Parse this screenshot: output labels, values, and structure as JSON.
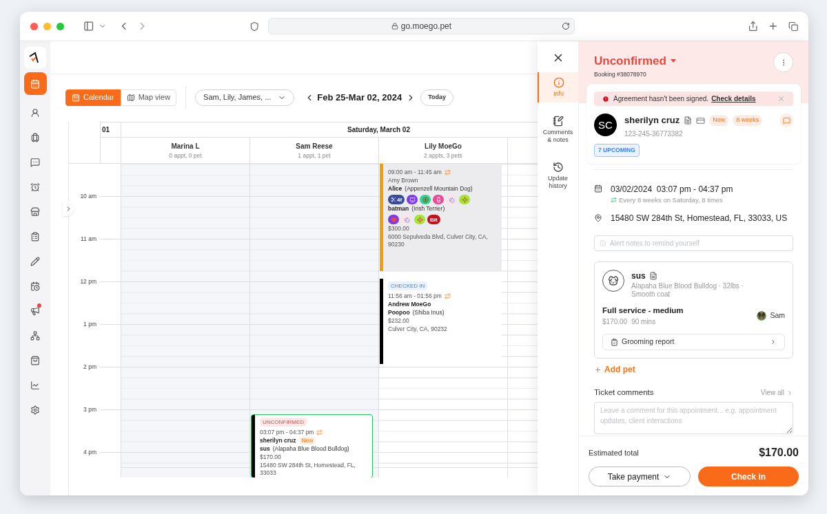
{
  "browser": {
    "url": "go.moego.pet"
  },
  "sidebar": {
    "items": [
      {
        "selected": true,
        "badge": false
      },
      {
        "selected": false,
        "badge": false
      },
      {
        "selected": false,
        "badge": false
      },
      {
        "selected": false,
        "badge": false
      },
      {
        "selected": false,
        "badge": false
      },
      {
        "selected": false,
        "badge": false
      },
      {
        "selected": false,
        "badge": false
      },
      {
        "selected": false,
        "badge": false
      },
      {
        "selected": false,
        "badge": false
      },
      {
        "selected": false,
        "badge": true
      },
      {
        "selected": false,
        "badge": false
      },
      {
        "selected": false,
        "badge": false
      },
      {
        "selected": false,
        "badge": false
      },
      {
        "selected": false,
        "badge": false
      }
    ]
  },
  "toolbar": {
    "view_tabs": [
      {
        "label": "Calendar",
        "selected": true
      },
      {
        "label": "Map view",
        "selected": false
      }
    ],
    "staff_filter": "Sam, Lily, James, ...",
    "date_range": "Feb 25-Mar 02, 2024",
    "today": "Today"
  },
  "calendar": {
    "week": "01",
    "day": "Saturday, March 02",
    "hours": [
      "10 am",
      "11 am",
      "12 pm",
      "1 pm",
      "2 pm",
      "3 pm",
      "4 pm"
    ],
    "staff": [
      {
        "name": "Marina L",
        "summary": "0 appt, 0 pet"
      },
      {
        "name": "Sam Reese",
        "summary": "1 appt, 1 pet",
        "appointments": [
          {
            "status": {
              "kind": "unconfirmed",
              "label": "UNCONFIRMED"
            },
            "time": "03:07 pm - 04:37 pm",
            "recurring": true,
            "client": "sherilyn cruz",
            "client_tag": "New",
            "color": "#000000",
            "highlighted": false,
            "selected": true,
            "pets": [
              {
                "name": "sus",
                "breed": "(Alapaha Blue Blood Bulldog)"
              }
            ],
            "price": "$170.00",
            "address": "15480 SW 284th St, Homestead, FL, 33033"
          }
        ]
      },
      {
        "name": "Lily MoeGo",
        "summary": "2 appts, 3 pets",
        "appointments": [
          {
            "time": "09:00 am - 11:45 am",
            "recurring": true,
            "client": "Amy Brown",
            "color": "#f59e0b",
            "highlighted": true,
            "selected": false,
            "pets": [
              {
                "name": "Alice",
                "breed": "(Appenzell Mountain Dog)",
                "tags": [
                  {
                    "kind": "count",
                    "label": "4f",
                    "color": "#3b4a9a"
                  },
                  {
                    "kind": "face",
                    "color": "#7c3aed"
                  },
                  {
                    "kind": "bag",
                    "color": "#34d399"
                  },
                  {
                    "kind": "bottle",
                    "color": "#ec4899"
                  },
                  {
                    "kind": "drops",
                    "color": "#fde2ea"
                  },
                  {
                    "kind": "burst",
                    "color": "#a3e635"
                  }
                ]
              },
              {
                "name": "batman",
                "breed": "(Irish Terrier)",
                "tags": [
                  {
                    "kind": "heart",
                    "color": "#7c3aed"
                  },
                  {
                    "kind": "drops",
                    "color": "#fde2ea"
                  },
                  {
                    "kind": "burst",
                    "color": "#a3e635"
                  },
                  {
                    "kind": "text",
                    "label": "Bit",
                    "color": "#c0121f"
                  }
                ]
              }
            ],
            "price": "$300.00",
            "address": "6000 Sepulveda Blvd, Culver City, CA, 90230"
          },
          {
            "status": {
              "kind": "checked_in",
              "label": "CHECKED IN"
            },
            "time": "11:56 am - 01:56 pm",
            "recurring": true,
            "client": "Andrew MoeGo",
            "color": "#000000",
            "highlighted": false,
            "selected": false,
            "pets": [
              {
                "name": "Poopoo",
                "breed": "(Shiba Inus)"
              }
            ],
            "price": "$232.00",
            "address": "Culver City, CA, 90232"
          }
        ]
      }
    ]
  },
  "drawer": {
    "tabs": [
      {
        "label": "Info",
        "selected": true
      },
      {
        "label": "Comments & notes",
        "selected": false
      },
      {
        "label": "Update history",
        "selected": false
      }
    ],
    "status": "Unconfirmed",
    "booking": "Booking #38078970",
    "alert": {
      "text": "Agreement hasn't been signed.",
      "link": "Check details"
    },
    "client": {
      "initials": "SC",
      "name": "sherilyn cruz",
      "tags": [
        "New",
        "8 weeks"
      ],
      "phone": "123-245-36773382",
      "upcoming": "7 UPCOMING"
    },
    "date": "03/02/2024  03:07 pm - 04:37 pm",
    "recurrence": "Every 8 weeks on Saturday, 8 times",
    "address": "15480 SW 284th St, Homestead, FL, 33033, US",
    "alert_notes": {
      "placeholder": "Alert notes to remind yourself"
    },
    "pet": {
      "name": "sus",
      "details": "Alapaha Blue Blood Bulldog · 32lbs · Smooth coat",
      "service": "Full service - medium",
      "price": "$170.00",
      "duration": "90 mins",
      "staff": "Sam",
      "report": "Grooming report"
    },
    "add_pet": "Add pet",
    "comments": {
      "title": "Ticket comments",
      "view_all": "View all",
      "placeholder": "Leave a comment for this appointment... e.g. appointment updates, client interactions"
    },
    "total": {
      "label": "Estimated total",
      "value": "$170.00"
    },
    "buttons": {
      "payment": "Take payment",
      "check_in": "Check in"
    }
  }
}
